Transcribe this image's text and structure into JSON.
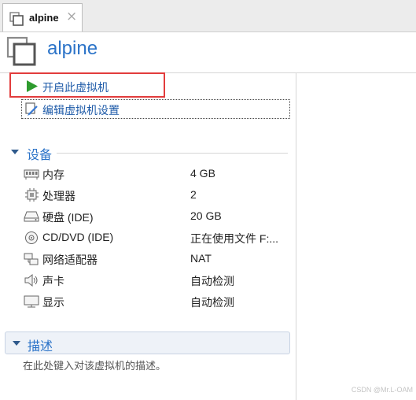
{
  "tab": {
    "label": "alpine",
    "close": "×"
  },
  "header": {
    "title": "alpine"
  },
  "actions": {
    "start": "开启此虚拟机",
    "edit": "编辑虚拟机设置"
  },
  "devices": {
    "heading": "设备",
    "items": [
      {
        "icon": "memory-icon",
        "name": "内存",
        "value": "4 GB"
      },
      {
        "icon": "cpu-icon",
        "name": "处理器",
        "value": "2"
      },
      {
        "icon": "disk-icon",
        "name": "硬盘 (IDE)",
        "value": "20 GB"
      },
      {
        "icon": "cd-icon",
        "name": "CD/DVD (IDE)",
        "value": "正在使用文件 F:..."
      },
      {
        "icon": "network-icon",
        "name": "网络适配器",
        "value": "NAT"
      },
      {
        "icon": "sound-icon",
        "name": "声卡",
        "value": "自动检测"
      },
      {
        "icon": "display-icon",
        "name": "显示",
        "value": "自动检测"
      }
    ]
  },
  "description": {
    "heading": "描述",
    "placeholder": "在此处键入对该虚拟机的描述。"
  },
  "watermark": "CSDN @Mr.L-OAM"
}
